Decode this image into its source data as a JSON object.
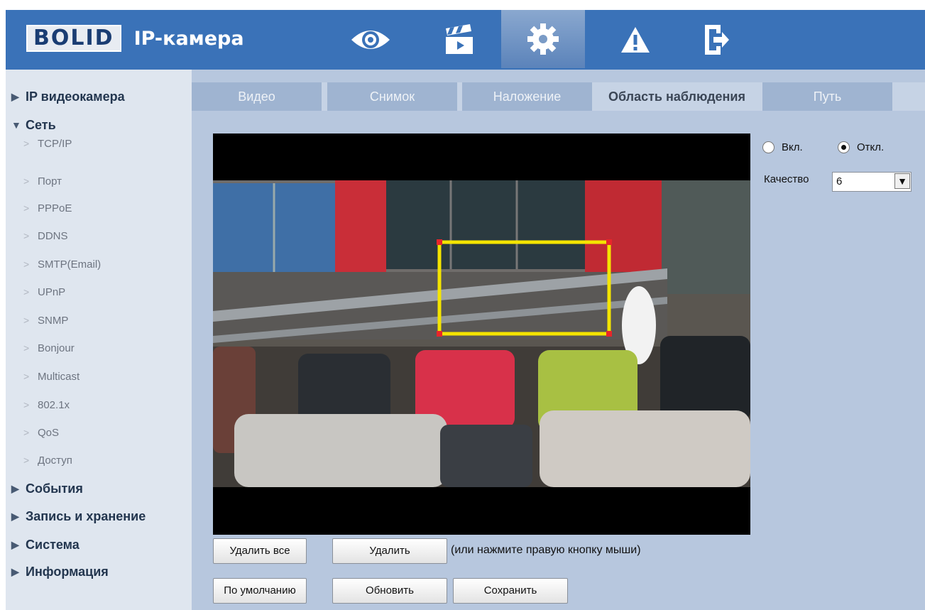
{
  "header": {
    "logo": "BOLID",
    "title": "IP-камера",
    "nav": [
      {
        "icon": "eye-icon",
        "active": false
      },
      {
        "icon": "clapperboard-icon",
        "active": false
      },
      {
        "icon": "gear-icon",
        "active": true
      },
      {
        "icon": "warning-icon",
        "active": false
      },
      {
        "icon": "exit-icon",
        "active": false
      }
    ]
  },
  "sidebar": {
    "ip_camera": "IP видеокамера",
    "network": "Сеть",
    "network_items": [
      "TCP/IP",
      "Порт",
      "PPPoE",
      "DDNS",
      "SMTP(Email)",
      "UPnP",
      "SNMP",
      "Bonjour",
      "Multicast",
      "802.1x",
      "QoS",
      "Доступ"
    ],
    "events": "События",
    "record": "Запись и хранение",
    "system": "Система",
    "info": "Информация"
  },
  "tabs": [
    "Видео",
    "Снимок",
    "Наложение",
    "Область наблюдения",
    "Путь"
  ],
  "active_tab": "Область наблюдения",
  "controls": {
    "on": "Вкл.",
    "off": "Откл.",
    "selected": "Откл.",
    "quality_label": "Качество",
    "quality_value": "6"
  },
  "buttons": {
    "delete_all": "Удалить все",
    "delete": "Удалить",
    "hint": "(или нажмите правую кнопку мыши)",
    "default": "По умолчанию",
    "refresh": "Обновить",
    "save": "Сохранить"
  },
  "colors": {
    "header": "#3a72b8",
    "roi_outline": "#f4e400",
    "roi_corner": "#e8262b"
  }
}
